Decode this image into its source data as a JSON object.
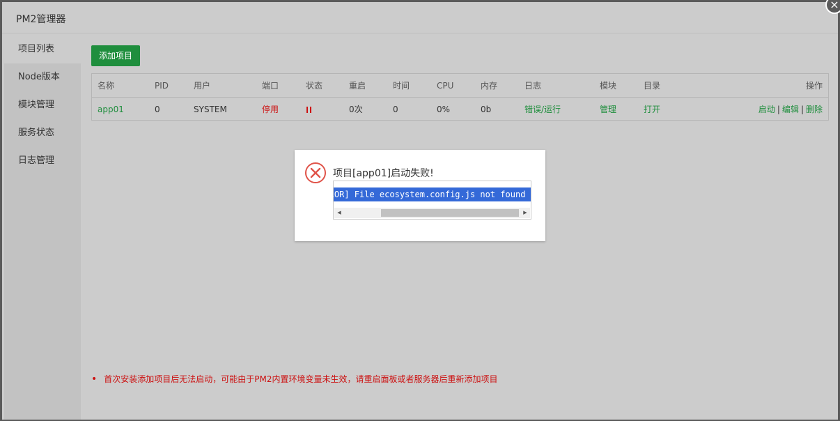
{
  "window": {
    "title": "PM2管理器",
    "close_icon": "close-icon"
  },
  "sidebar": {
    "items": [
      {
        "label": "项目列表",
        "active": true
      },
      {
        "label": "Node版本",
        "active": false
      },
      {
        "label": "模块管理",
        "active": false
      },
      {
        "label": "服务状态",
        "active": false
      },
      {
        "label": "日志管理",
        "active": false
      }
    ]
  },
  "toolbar": {
    "add_label": "添加项目"
  },
  "table": {
    "headers": {
      "name": "名称",
      "pid": "PID",
      "user": "用户",
      "port": "端口",
      "status": "状态",
      "restart": "重启",
      "time": "时间",
      "cpu": "CPU",
      "mem": "内存",
      "log": "日志",
      "module": "模块",
      "dir": "目录",
      "ops": "操作"
    },
    "rows": [
      {
        "name": "app01",
        "pid": "0",
        "user": "SYSTEM",
        "port": "停用",
        "status_icon": "pause-icon",
        "restart": "0次",
        "time": "0",
        "cpu": "0%",
        "mem": "0b",
        "log": "错误/运行",
        "module": "管理",
        "dir": "打开",
        "op_start": "启动",
        "op_edit": "编辑",
        "op_delete": "删除",
        "op_sep": "|"
      }
    ]
  },
  "note": {
    "text": "首次安装添加项目后无法启动，可能由于PM2内置环境变量未生效，请重启面板或者服务器后重新添加项目"
  },
  "dialog": {
    "icon": "error-circle-icon",
    "message": "项目[app01]启动失败!",
    "code": "[ERROR] File ecosystem.config.js not found"
  },
  "colors": {
    "accent_green": "#1f8e3d",
    "error_red": "#cc1111",
    "selection_blue": "#3469d8",
    "overlay_gray": "#cccccc"
  }
}
